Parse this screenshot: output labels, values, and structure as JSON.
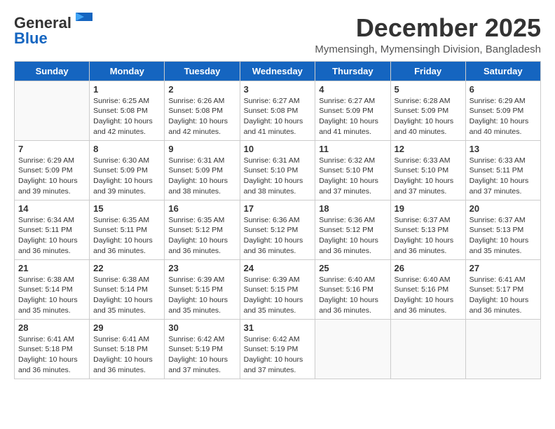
{
  "logo": {
    "general": "General",
    "blue": "Blue"
  },
  "title": "December 2025",
  "subtitle": "Mymensingh, Mymensingh Division, Bangladesh",
  "weekdays": [
    "Sunday",
    "Monday",
    "Tuesday",
    "Wednesday",
    "Thursday",
    "Friday",
    "Saturday"
  ],
  "weeks": [
    [
      {
        "day": "",
        "info": ""
      },
      {
        "day": "1",
        "info": "Sunrise: 6:25 AM\nSunset: 5:08 PM\nDaylight: 10 hours\nand 42 minutes."
      },
      {
        "day": "2",
        "info": "Sunrise: 6:26 AM\nSunset: 5:08 PM\nDaylight: 10 hours\nand 42 minutes."
      },
      {
        "day": "3",
        "info": "Sunrise: 6:27 AM\nSunset: 5:08 PM\nDaylight: 10 hours\nand 41 minutes."
      },
      {
        "day": "4",
        "info": "Sunrise: 6:27 AM\nSunset: 5:09 PM\nDaylight: 10 hours\nand 41 minutes."
      },
      {
        "day": "5",
        "info": "Sunrise: 6:28 AM\nSunset: 5:09 PM\nDaylight: 10 hours\nand 40 minutes."
      },
      {
        "day": "6",
        "info": "Sunrise: 6:29 AM\nSunset: 5:09 PM\nDaylight: 10 hours\nand 40 minutes."
      }
    ],
    [
      {
        "day": "7",
        "info": "Sunrise: 6:29 AM\nSunset: 5:09 PM\nDaylight: 10 hours\nand 39 minutes."
      },
      {
        "day": "8",
        "info": "Sunrise: 6:30 AM\nSunset: 5:09 PM\nDaylight: 10 hours\nand 39 minutes."
      },
      {
        "day": "9",
        "info": "Sunrise: 6:31 AM\nSunset: 5:09 PM\nDaylight: 10 hours\nand 38 minutes."
      },
      {
        "day": "10",
        "info": "Sunrise: 6:31 AM\nSunset: 5:10 PM\nDaylight: 10 hours\nand 38 minutes."
      },
      {
        "day": "11",
        "info": "Sunrise: 6:32 AM\nSunset: 5:10 PM\nDaylight: 10 hours\nand 37 minutes."
      },
      {
        "day": "12",
        "info": "Sunrise: 6:33 AM\nSunset: 5:10 PM\nDaylight: 10 hours\nand 37 minutes."
      },
      {
        "day": "13",
        "info": "Sunrise: 6:33 AM\nSunset: 5:11 PM\nDaylight: 10 hours\nand 37 minutes."
      }
    ],
    [
      {
        "day": "14",
        "info": "Sunrise: 6:34 AM\nSunset: 5:11 PM\nDaylight: 10 hours\nand 36 minutes."
      },
      {
        "day": "15",
        "info": "Sunrise: 6:35 AM\nSunset: 5:11 PM\nDaylight: 10 hours\nand 36 minutes."
      },
      {
        "day": "16",
        "info": "Sunrise: 6:35 AM\nSunset: 5:12 PM\nDaylight: 10 hours\nand 36 minutes."
      },
      {
        "day": "17",
        "info": "Sunrise: 6:36 AM\nSunset: 5:12 PM\nDaylight: 10 hours\nand 36 minutes."
      },
      {
        "day": "18",
        "info": "Sunrise: 6:36 AM\nSunset: 5:12 PM\nDaylight: 10 hours\nand 36 minutes."
      },
      {
        "day": "19",
        "info": "Sunrise: 6:37 AM\nSunset: 5:13 PM\nDaylight: 10 hours\nand 36 minutes."
      },
      {
        "day": "20",
        "info": "Sunrise: 6:37 AM\nSunset: 5:13 PM\nDaylight: 10 hours\nand 35 minutes."
      }
    ],
    [
      {
        "day": "21",
        "info": "Sunrise: 6:38 AM\nSunset: 5:14 PM\nDaylight: 10 hours\nand 35 minutes."
      },
      {
        "day": "22",
        "info": "Sunrise: 6:38 AM\nSunset: 5:14 PM\nDaylight: 10 hours\nand 35 minutes."
      },
      {
        "day": "23",
        "info": "Sunrise: 6:39 AM\nSunset: 5:15 PM\nDaylight: 10 hours\nand 35 minutes."
      },
      {
        "day": "24",
        "info": "Sunrise: 6:39 AM\nSunset: 5:15 PM\nDaylight: 10 hours\nand 35 minutes."
      },
      {
        "day": "25",
        "info": "Sunrise: 6:40 AM\nSunset: 5:16 PM\nDaylight: 10 hours\nand 36 minutes."
      },
      {
        "day": "26",
        "info": "Sunrise: 6:40 AM\nSunset: 5:16 PM\nDaylight: 10 hours\nand 36 minutes."
      },
      {
        "day": "27",
        "info": "Sunrise: 6:41 AM\nSunset: 5:17 PM\nDaylight: 10 hours\nand 36 minutes."
      }
    ],
    [
      {
        "day": "28",
        "info": "Sunrise: 6:41 AM\nSunset: 5:18 PM\nDaylight: 10 hours\nand 36 minutes."
      },
      {
        "day": "29",
        "info": "Sunrise: 6:41 AM\nSunset: 5:18 PM\nDaylight: 10 hours\nand 36 minutes."
      },
      {
        "day": "30",
        "info": "Sunrise: 6:42 AM\nSunset: 5:19 PM\nDaylight: 10 hours\nand 37 minutes."
      },
      {
        "day": "31",
        "info": "Sunrise: 6:42 AM\nSunset: 5:19 PM\nDaylight: 10 hours\nand 37 minutes."
      },
      {
        "day": "",
        "info": ""
      },
      {
        "day": "",
        "info": ""
      },
      {
        "day": "",
        "info": ""
      }
    ]
  ]
}
